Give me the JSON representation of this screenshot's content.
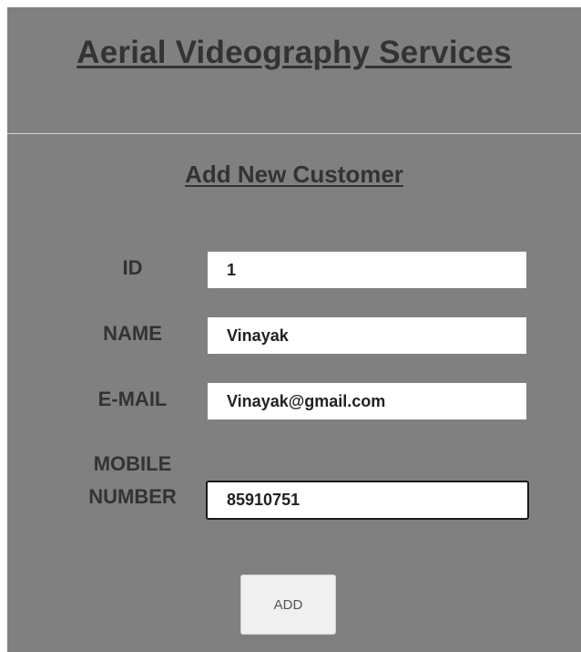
{
  "header": {
    "title": "Aerial Videography Services"
  },
  "form": {
    "title": "Add New Customer",
    "fields": [
      {
        "label": "ID",
        "value": "1"
      },
      {
        "label": "NAME",
        "value": "Vinayak"
      },
      {
        "label": "E-MAIL",
        "value": "Vinayak@gmail.com"
      },
      {
        "label_line1": "MOBILE",
        "label_line2": "NUMBER",
        "value": "85910751",
        "focused": true
      }
    ],
    "submit_label": "ADD"
  },
  "colors": {
    "background": "#808080",
    "text": "#333333",
    "input_background": "#ffffff",
    "button_background": "#f0f0f0"
  }
}
